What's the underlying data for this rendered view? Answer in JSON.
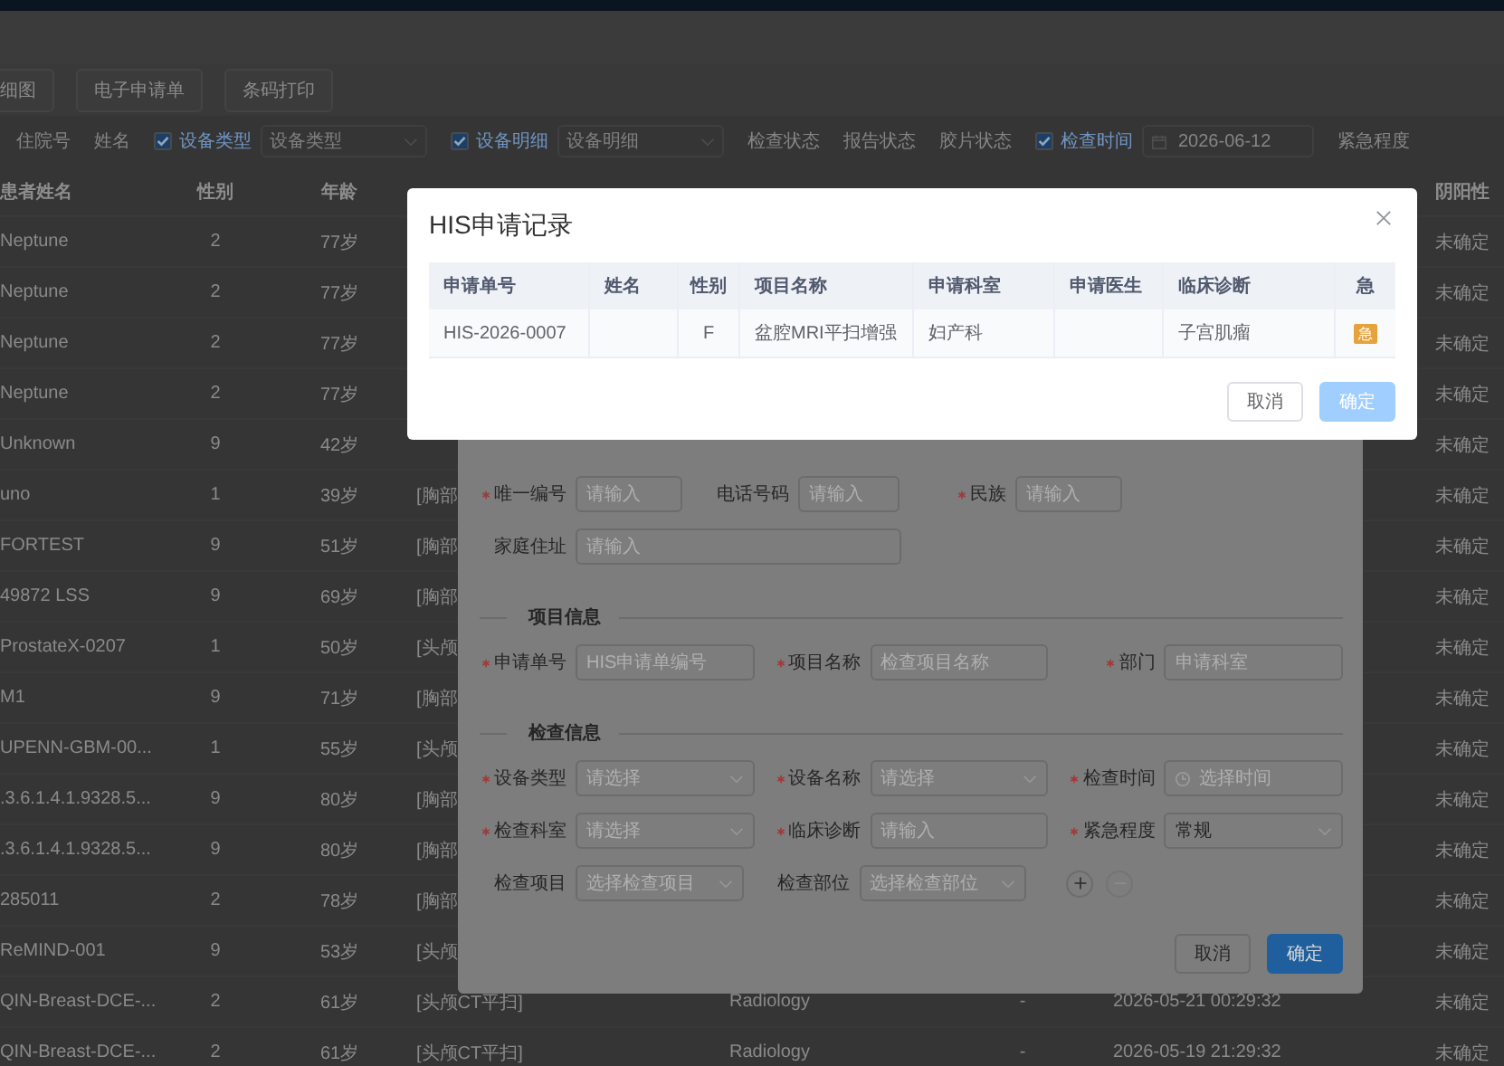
{
  "toolbar": {
    "buttons": [
      "细图",
      "电子申请单",
      "条码打印"
    ]
  },
  "filters": [
    {
      "kind": "label",
      "label": "住院号"
    },
    {
      "kind": "label",
      "label": "姓名"
    },
    {
      "kind": "check",
      "label": "设备类型",
      "checked": true
    },
    {
      "kind": "select",
      "placeholder": "设备类型"
    },
    {
      "kind": "check",
      "label": "设备明细",
      "checked": true
    },
    {
      "kind": "select",
      "placeholder": "设备明细"
    },
    {
      "kind": "label",
      "label": "检查状态"
    },
    {
      "kind": "label",
      "label": "报告状态"
    },
    {
      "kind": "label",
      "label": "胶片状态"
    },
    {
      "kind": "check",
      "label": "检查时间",
      "checked": true
    },
    {
      "kind": "date",
      "value": "2026-06-12"
    },
    {
      "kind": "label",
      "label": "紧急程度"
    }
  ],
  "table": {
    "header": {
      "name": "患者姓名",
      "sex": "性别",
      "age": "年龄",
      "result": "阴阳性"
    },
    "rows": [
      {
        "name": "Neptune",
        "sex": "2",
        "age": "77岁",
        "result": "未确定"
      },
      {
        "name": "Neptune",
        "sex": "2",
        "age": "77岁",
        "result": "未确定"
      },
      {
        "name": "Neptune",
        "sex": "2",
        "age": "77岁",
        "result": "未确定"
      },
      {
        "name": "Neptune",
        "sex": "2",
        "age": "77岁",
        "result": "未确定"
      },
      {
        "name": "Unknown",
        "sex": "9",
        "age": "42岁",
        "result": "未确定"
      },
      {
        "name": "uno",
        "sex": "1",
        "age": "39岁",
        "item": "[胸部",
        "result": "未确定"
      },
      {
        "name": "FORTEST",
        "sex": "9",
        "age": "51岁",
        "item": "[胸部",
        "result": "未确定"
      },
      {
        "name": "49872 LSS",
        "sex": "9",
        "age": "69岁",
        "item": "[胸部",
        "result": "未确定"
      },
      {
        "name": "ProstateX-0207",
        "sex": "1",
        "age": "50岁",
        "item": "[头颅",
        "result": "未确定"
      },
      {
        "name": "M1",
        "sex": "9",
        "age": "71岁",
        "item": "[胸部",
        "result": "未确定"
      },
      {
        "name": "UPENN-GBM-00...",
        "sex": "1",
        "age": "55岁",
        "item": "[头颅",
        "result": "未确定"
      },
      {
        "name": ".3.6.1.4.1.9328.5...",
        "sex": "9",
        "age": "80岁",
        "item": "[胸部",
        "result": "未确定"
      },
      {
        "name": ".3.6.1.4.1.9328.5...",
        "sex": "9",
        "age": "80岁",
        "item": "[胸部",
        "result": "未确定"
      },
      {
        "name": "285011",
        "sex": "2",
        "age": "78岁",
        "item": "[胸部",
        "result": "未确定"
      },
      {
        "name": "ReMIND-001",
        "sex": "9",
        "age": "53岁",
        "item": "[头颅",
        "result": "未确定"
      },
      {
        "name": "QIN-Breast-DCE-...",
        "sex": "2",
        "age": "61岁",
        "item": "[头颅CT平扫]",
        "source": "Radiology",
        "ward": "-",
        "time": "2026-05-21 00:29:32",
        "result": "未确定"
      },
      {
        "name": "QIN-Breast-DCE-...",
        "sex": "2",
        "age": "61岁",
        "item": "[头颅CT平扫]",
        "source": "Radiology",
        "ward": "-",
        "time": "2026-05-19 21:29:32",
        "result": "未确定"
      }
    ]
  },
  "form_dialog": {
    "sections": [
      {
        "rows": [
          {
            "kind": "short",
            "fields": [
              {
                "kind": "input",
                "label": "唯一编号",
                "required": true,
                "placeholder": "请输入"
              },
              {
                "kind": "input",
                "label": "电话号码",
                "required": false,
                "placeholder": "请输入"
              },
              {
                "kind": "input",
                "label": "民族",
                "required": true,
                "placeholder": "请输入"
              }
            ]
          },
          {
            "kind": "short",
            "fields": [
              {
                "kind": "wide",
                "label": "家庭住址",
                "required": false,
                "placeholder": "请输入"
              }
            ]
          }
        ]
      },
      {
        "title": "项目信息",
        "rows": [
          {
            "kind": "full",
            "fields": [
              {
                "kind": "input",
                "label": "申请单号",
                "required": true,
                "placeholder": "HIS申请单编号"
              },
              {
                "kind": "input",
                "label": "项目名称",
                "required": true,
                "placeholder": "检查项目名称"
              },
              {
                "kind": "input",
                "label": "部门",
                "required": true,
                "placeholder": "申请科室"
              }
            ]
          }
        ]
      },
      {
        "title": "检查信息",
        "rows": [
          {
            "kind": "full",
            "fields": [
              {
                "kind": "select",
                "label": "设备类型",
                "required": true,
                "placeholder": "请选择"
              },
              {
                "kind": "select",
                "label": "设备名称",
                "required": true,
                "placeholder": "请选择"
              },
              {
                "kind": "time",
                "label": "检查时间",
                "required": true,
                "placeholder": "选择时间"
              }
            ]
          },
          {
            "kind": "full",
            "fields": [
              {
                "kind": "select",
                "label": "检查科室",
                "required": true,
                "placeholder": "请选择"
              },
              {
                "kind": "input",
                "label": "临床诊断",
                "required": true,
                "placeholder": "请输入"
              },
              {
                "kind": "select",
                "label": "紧急程度",
                "required": true,
                "value": "常规"
              }
            ]
          },
          {
            "kind": "full",
            "fields": [
              {
                "kind": "select",
                "label": "检查项目",
                "required": false,
                "placeholder": "选择检查项目"
              },
              {
                "kind": "select",
                "label": "检查部位",
                "required": false,
                "placeholder": "选择检查部位"
              },
              {
                "kind": "adders",
                "remove_disabled": true
              }
            ]
          }
        ]
      }
    ],
    "buttons": [
      {
        "label": "取消",
        "kind": "default",
        "disabled": false
      },
      {
        "label": "确定",
        "kind": "primary",
        "disabled": false
      }
    ]
  },
  "his_dialog": {
    "title": "HIS申请记录",
    "columns": [
      "申请单号",
      "姓名",
      "性别",
      "项目名称",
      "申请科室",
      "申请医生",
      "临床诊断",
      "急"
    ],
    "rows": [
      {
        "id": "HIS-2026-0007",
        "sex": "F",
        "item": "盆腔MRI平扫增强",
        "dept": "妇产科",
        "diagnosis": "子宫肌瘤",
        "urgent": true,
        "urgent_label": "急"
      }
    ],
    "buttons": [
      {
        "label": "取消",
        "kind": "default",
        "disabled": false
      },
      {
        "label": "确定",
        "kind": "primary",
        "disabled": true
      }
    ]
  }
}
